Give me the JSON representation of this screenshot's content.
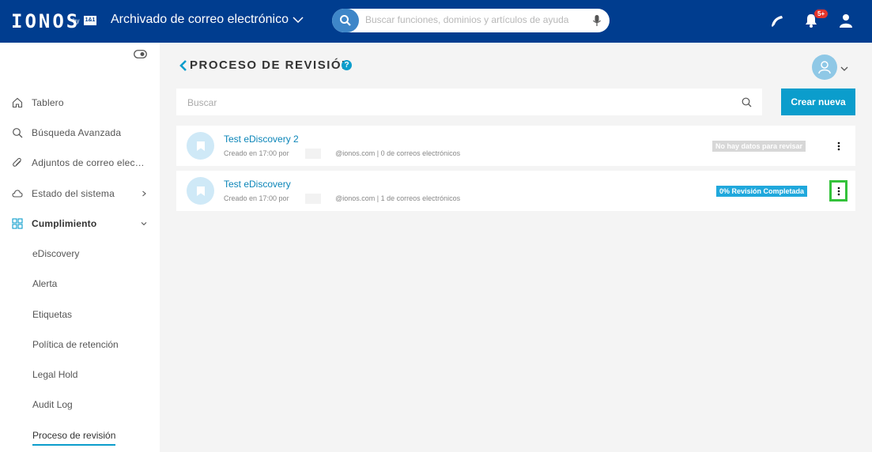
{
  "topbar": {
    "logo": "IONOS",
    "logo_by": "by",
    "logo_brand": "1&1",
    "app_title": "Archivado de correo electrónico",
    "search_placeholder": "Buscar funciones, dominios y artículos de ayuda",
    "notification_count": "5+"
  },
  "sidebar": {
    "items": [
      {
        "label": "Tablero",
        "icon": "home-icon"
      },
      {
        "label": "Búsqueda Avanzada",
        "icon": "search-icon"
      },
      {
        "label": "Adjuntos de correo elec…",
        "icon": "paperclip-icon"
      },
      {
        "label": "Estado del sistema",
        "icon": "cloud-icon"
      },
      {
        "label": "Cumplimiento",
        "icon": "grid-icon"
      }
    ],
    "sub_items": [
      {
        "label": "eDiscovery"
      },
      {
        "label": "Alerta"
      },
      {
        "label": "Etiquetas"
      },
      {
        "label": "Política de retención"
      },
      {
        "label": "Legal Hold"
      },
      {
        "label": "Audit Log"
      },
      {
        "label": "Proceso de revisión"
      }
    ]
  },
  "main": {
    "title": "PROCESO DE REVISIÓN",
    "help": "?",
    "search_placeholder": "Buscar",
    "create_button": "Crear nueva",
    "reviews": [
      {
        "title": "Test eDiscovery 2",
        "created": "Creado en 17:00 por",
        "email_domain": "@ionos.com",
        "emails": "| 0 de correos electrónicos",
        "status": "No hay datos para revisar",
        "status_color": "#d7d7d7"
      },
      {
        "title": "Test eDiscovery",
        "created": "Creado en 17:00 por",
        "email_domain": "@ionos.com",
        "emails": "| 1 de correos electrónicos",
        "status": "0% Revisión Completada",
        "status_color": "#20a8dc"
      }
    ]
  },
  "colors": {
    "topbar": "#003d8f",
    "accent": "#0b9dcc",
    "highlight": "#33c23a"
  }
}
